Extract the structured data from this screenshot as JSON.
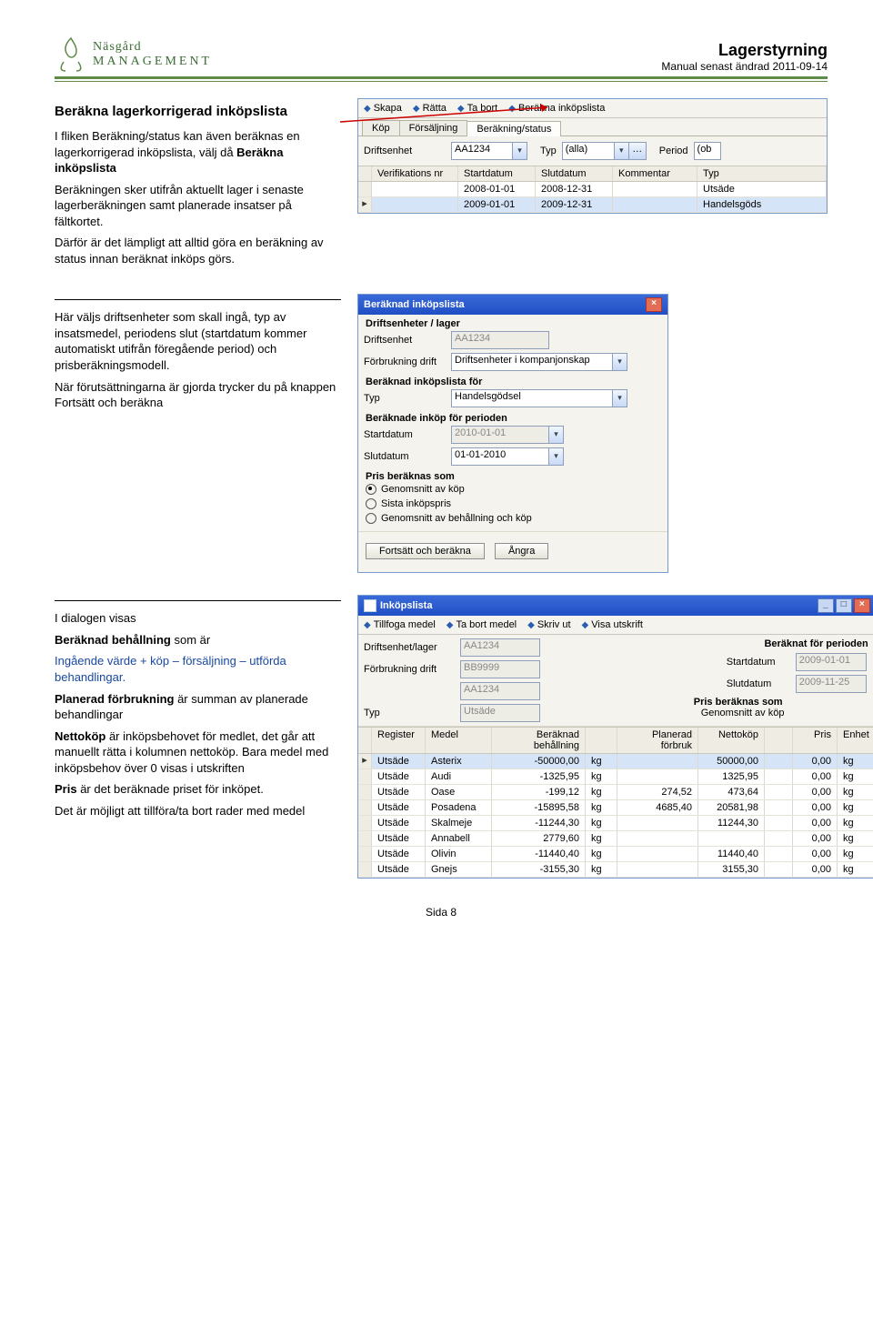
{
  "header": {
    "brand_top": "Näsgård",
    "brand_bot": "MANAGEMENT",
    "title": "Lagerstyrning",
    "subtitle": "Manual senast ändrad 2011-09-14"
  },
  "section1": {
    "heading": "Beräkna lagerkorrigerad inköpslista",
    "para1_a": "I fliken Beräkning/status kan även beräknas en lagerkorrigerad inköpslista, välj då ",
    "para1_b": "Beräkna inköpslista",
    "para2": "Beräkningen sker utifrån aktuellt lager i senaste lagerberäkningen samt planerade insatser på fältkortet.",
    "para3": "Därför är det lämpligt att alltid göra en beräkning av status innan beräknat inköps görs."
  },
  "shot1": {
    "toolbar": [
      "Skapa",
      "Rätta",
      "Ta bort",
      "Beräkna inköpslista"
    ],
    "tabs": [
      "Köp",
      "Försäljning",
      "Beräkning/status"
    ],
    "row1": {
      "l1": "Driftsenhet",
      "v1": "AA1234",
      "l2": "Typ",
      "v2": "(alla)",
      "l3": "Period",
      "v3": "(ob"
    },
    "grid_head": [
      "Verifikations nr",
      "Startdatum",
      "Slutdatum",
      "Kommentar",
      "Typ"
    ],
    "rows": [
      {
        "start": "2008-01-01",
        "end": "2008-12-31",
        "typ": "Utsäde"
      },
      {
        "start": "2009-01-01",
        "end": "2009-12-31",
        "typ": "Handelsgöds"
      }
    ]
  },
  "section2": {
    "para1": "Här väljs driftsenheter som skall ingå, typ av insatsmedel, periodens slut (startdatum kommer automatiskt utifrån föregående period) och prisberäkningsmodell.",
    "para2": "När förutsättningarna är gjorda trycker du på knappen Fortsätt och beräkna"
  },
  "dialog": {
    "title": "Beräknad inköpslista",
    "g1": "Driftsenheter / lager",
    "l_drift": "Driftsenhet",
    "v_drift": "AA1234",
    "l_forb": "Förbrukning drift",
    "v_forb": "Driftsenheter i kompanjonskap",
    "g2": "Beräknad inköpslista för",
    "l_typ": "Typ",
    "v_typ": "Handelsgödsel",
    "g3": "Beräknade inköp för perioden",
    "l_start": "Startdatum",
    "v_start": "2010-01-01",
    "l_slut": "Slutdatum",
    "v_slut": "01-01-2010",
    "g4": "Pris beräknas som",
    "r1": "Genomsnitt av köp",
    "r2": "Sista inköpspris",
    "r3": "Genomsnitt av behållning och köp",
    "btn_ok": "Fortsätt och beräkna",
    "btn_cancel": "Ångra"
  },
  "section3": {
    "p1a": "I dialogen visas",
    "p1b": "Beräknad behållning",
    "p1c": " som är",
    "p2": "Ingående värde + köp – försäljning – utförda behandlingar.",
    "p3a": "Planerad förbrukning",
    "p3b": " är summan av planerade behandlingar",
    "p4a": "Nettoköp",
    "p4b": " är inköpsbehovet för medlet, det går att manuellt rätta i kolumnen nettoköp. Bara medel med inköpsbehov över 0 visas i utskriften",
    "p5a": "Pris",
    "p5b": " är det beräknade priset för inköpet.",
    "p6": "Det är möjligt att tillföra/ta bort rader med medel"
  },
  "shot3": {
    "title": "Inköpslista",
    "toolbar": [
      "Tillfoga medel",
      "Ta bort medel",
      "Skriv ut",
      "Visa utskrift"
    ],
    "l_de": "Driftsenhet/lager",
    "v_de": "AA1234",
    "l_fd": "Förbrukning drift",
    "v_fd1": "BB9999",
    "v_fd2": "AA1234",
    "l_bp": "Beräknat för perioden",
    "l_sd": "Startdatum",
    "v_sd": "2009-01-01",
    "l_ed": "Slutdatum",
    "v_ed": "2009-11-25",
    "l_pbs": "Pris beräknas som",
    "v_pbs": "Genomsnitt av köp",
    "l_typ": "Typ",
    "v_typ": "Utsäde",
    "grid_head": [
      "Register",
      "Medel",
      "Beräknad behållning",
      "",
      "Planerad förbruk",
      "Nettoköp",
      "",
      "Pris",
      "Enhet"
    ],
    "rows": [
      {
        "reg": "Utsäde",
        "med": "Asterix",
        "bb": "-50000,00",
        "u": "kg",
        "pf": "",
        "nk": "50000,00",
        "u2": "",
        "pr": "0,00",
        "en": "kg"
      },
      {
        "reg": "Utsäde",
        "med": "Audi",
        "bb": "-1325,95",
        "u": "kg",
        "pf": "",
        "nk": "1325,95",
        "u2": "",
        "pr": "0,00",
        "en": "kg"
      },
      {
        "reg": "Utsäde",
        "med": "Oase",
        "bb": "-199,12",
        "u": "kg",
        "pf": "274,52",
        "nk": "473,64",
        "u2": "",
        "pr": "0,00",
        "en": "kg"
      },
      {
        "reg": "Utsäde",
        "med": "Posadena",
        "bb": "-15895,58",
        "u": "kg",
        "pf": "4685,40",
        "nk": "20581,98",
        "u2": "",
        "pr": "0,00",
        "en": "kg"
      },
      {
        "reg": "Utsäde",
        "med": "Skalmeje",
        "bb": "-11244,30",
        "u": "kg",
        "pf": "",
        "nk": "11244,30",
        "u2": "",
        "pr": "0,00",
        "en": "kg"
      },
      {
        "reg": "Utsäde",
        "med": "Annabell",
        "bb": "2779,60",
        "u": "kg",
        "pf": "",
        "nk": "",
        "u2": "",
        "pr": "0,00",
        "en": "kg"
      },
      {
        "reg": "Utsäde",
        "med": "Olivin",
        "bb": "-11440,40",
        "u": "kg",
        "pf": "",
        "nk": "11440,40",
        "u2": "",
        "pr": "0,00",
        "en": "kg"
      },
      {
        "reg": "Utsäde",
        "med": "Gnejs",
        "bb": "-3155,30",
        "u": "kg",
        "pf": "",
        "nk": "3155,30",
        "u2": "",
        "pr": "0,00",
        "en": "kg"
      }
    ]
  },
  "footer": "Sida 8"
}
